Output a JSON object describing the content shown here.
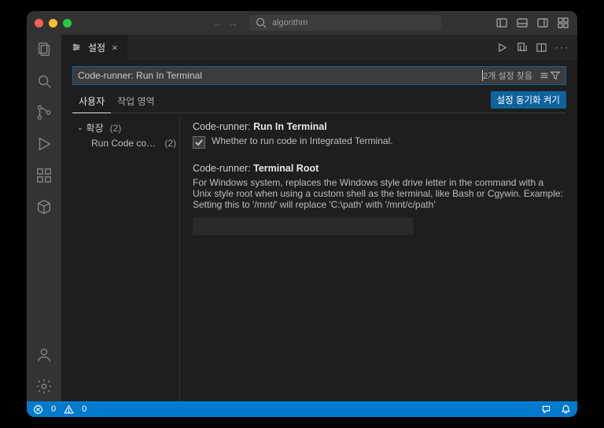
{
  "titlebar": {
    "search_prefix_icon": "search",
    "search_placeholder": "algorithm"
  },
  "tab": {
    "title": "설정"
  },
  "settings": {
    "search_value": "Code-runner: Run In Terminal",
    "result_count": "2개 설정 찾음",
    "scope_user": "사용자",
    "scope_workspace": "작업 영역",
    "sync_button": "설정 동기화 켜기"
  },
  "tree": {
    "group_label": "확장",
    "group_count": "(2)",
    "item1_label": "Run Code config...",
    "item1_count": "(2)"
  },
  "item1": {
    "prefix": "Code-runner:",
    "name": "Run In Terminal",
    "desc": "Whether to run code in Integrated Terminal."
  },
  "item2": {
    "prefix": "Code-runner:",
    "name": "Terminal Root",
    "desc": "For Windows system, replaces the Windows style drive letter in the command with a Unix style root when using a custom shell as the terminal, like Bash or Cgywin. Example: Setting this to '/mnt/' will replace 'C:\\path' with '/mnt/c/path'"
  },
  "statusbar": {
    "errors": "0",
    "warnings": "0"
  }
}
